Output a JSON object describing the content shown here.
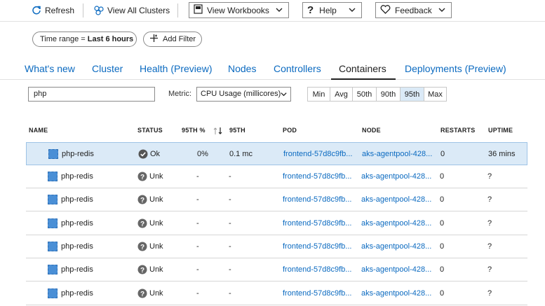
{
  "toolbar": {
    "refresh": "Refresh",
    "view_all_clusters": "View All Clusters",
    "view_workbooks": "View Workbooks",
    "help": "Help",
    "feedback": "Feedback"
  },
  "filters": {
    "time_range_prefix": "Time range = ",
    "time_range_value": "Last 6 hours",
    "add_filter": "Add Filter"
  },
  "tabs": [
    {
      "label": "What's new"
    },
    {
      "label": "Cluster"
    },
    {
      "label": "Health (Preview)"
    },
    {
      "label": "Nodes"
    },
    {
      "label": "Controllers"
    },
    {
      "label": "Containers",
      "active": true
    },
    {
      "label": "Deployments (Preview)"
    }
  ],
  "search": {
    "value": "php"
  },
  "metric": {
    "label": "Metric:",
    "selected": "CPU Usage (millicores)"
  },
  "percentiles": {
    "options": [
      "Min",
      "Avg",
      "50th",
      "90th",
      "95th",
      "Max"
    ],
    "selected": "95th"
  },
  "table": {
    "columns": [
      "NAME",
      "STATUS",
      "95TH %",
      "95TH",
      "POD",
      "NODE",
      "RESTARTS",
      "UPTIME"
    ],
    "rows": [
      {
        "name": "php-redis",
        "status": "Ok",
        "pct": "0%",
        "value": "0.1 mc",
        "pod": "frontend-57d8c9fb...",
        "node": "aks-agentpool-428...",
        "restarts": "0",
        "uptime": "36 mins",
        "selected": true
      },
      {
        "name": "php-redis",
        "status": "Unk",
        "pct": "-",
        "value": "-",
        "pod": "frontend-57d8c9fb...",
        "node": "aks-agentpool-428...",
        "restarts": "0",
        "uptime": "?"
      },
      {
        "name": "php-redis",
        "status": "Unk",
        "pct": "-",
        "value": "-",
        "pod": "frontend-57d8c9fb...",
        "node": "aks-agentpool-428...",
        "restarts": "0",
        "uptime": "?"
      },
      {
        "name": "php-redis",
        "status": "Unk",
        "pct": "-",
        "value": "-",
        "pod": "frontend-57d8c9fb...",
        "node": "aks-agentpool-428...",
        "restarts": "0",
        "uptime": "?"
      },
      {
        "name": "php-redis",
        "status": "Unk",
        "pct": "-",
        "value": "-",
        "pod": "frontend-57d8c9fb...",
        "node": "aks-agentpool-428...",
        "restarts": "0",
        "uptime": "?"
      },
      {
        "name": "php-redis",
        "status": "Unk",
        "pct": "-",
        "value": "-",
        "pod": "frontend-57d8c9fb...",
        "node": "aks-agentpool-428...",
        "restarts": "0",
        "uptime": "?"
      },
      {
        "name": "php-redis",
        "status": "Unk",
        "pct": "-",
        "value": "-",
        "pod": "frontend-57d8c9fb...",
        "node": "aks-agentpool-428...",
        "restarts": "0",
        "uptime": "?"
      }
    ]
  },
  "icons": {
    "refresh": "refresh-icon",
    "clusters": "clusters-icon",
    "workbook": "workbook-icon",
    "help": "question-icon",
    "feedback": "heart-icon",
    "chevron": "chevron-down-icon",
    "add_filter": "add-filter-icon",
    "sort": "sort-arrows-icon",
    "container": "container-icon",
    "status_ok": "check-circle-icon",
    "status_unknown": "question-circle-icon"
  },
  "colors": {
    "link": "#0b6ac0",
    "selected_row": "#dbeaf7",
    "status_icon": "#555555"
  }
}
